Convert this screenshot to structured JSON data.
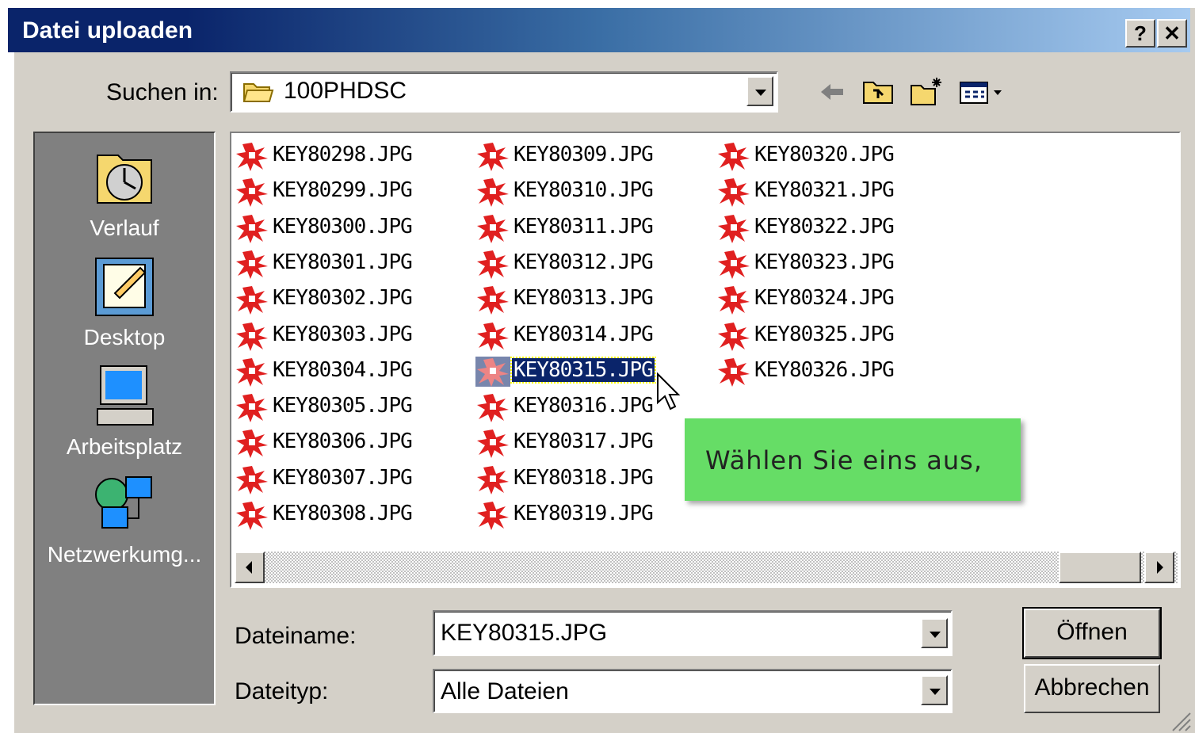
{
  "window": {
    "title": "Datei uploaden",
    "help_btn": "?",
    "close_btn": "✕"
  },
  "lookin": {
    "label": "Suchen in:",
    "value": "100PHDSC"
  },
  "toolbar_icons": [
    "back-arrow-icon",
    "up-folder-icon",
    "new-folder-icon",
    "view-menu-icon"
  ],
  "places": [
    {
      "label": "Verlauf",
      "icon": "history-icon"
    },
    {
      "label": "Desktop",
      "icon": "desktop-icon"
    },
    {
      "label": "Arbeitsplatz",
      "icon": "my-computer-icon"
    },
    {
      "label": "Netzwerkumg...",
      "icon": "network-icon"
    }
  ],
  "files": {
    "col1": [
      "KEY80298.JPG",
      "KEY80299.JPG",
      "KEY80300.JPG",
      "KEY80301.JPG",
      "KEY80302.JPG",
      "KEY80303.JPG",
      "KEY80304.JPG",
      "KEY80305.JPG",
      "KEY80306.JPG",
      "KEY80307.JPG",
      "KEY80308.JPG"
    ],
    "col2": [
      "KEY80309.JPG",
      "KEY80310.JPG",
      "KEY80311.JPG",
      "KEY80312.JPG",
      "KEY80313.JPG",
      "KEY80314.JPG",
      "KEY80315.JPG",
      "KEY80316.JPG",
      "KEY80317.JPG",
      "KEY80318.JPG",
      "KEY80319.JPG"
    ],
    "col3": [
      "KEY80320.JPG",
      "KEY80321.JPG",
      "KEY80322.JPG",
      "KEY80323.JPG",
      "KEY80324.JPG",
      "KEY80325.JPG",
      "KEY80326.JPG"
    ],
    "selected": "KEY80315.JPG"
  },
  "filename": {
    "label": "Dateiname:",
    "value": "KEY80315.JPG"
  },
  "filetype": {
    "label": "Dateityp:",
    "value": "Alle Dateien"
  },
  "buttons": {
    "open": "Öffnen",
    "cancel": "Abbrechen"
  },
  "tooltip": "Wählen Sie eins aus,"
}
